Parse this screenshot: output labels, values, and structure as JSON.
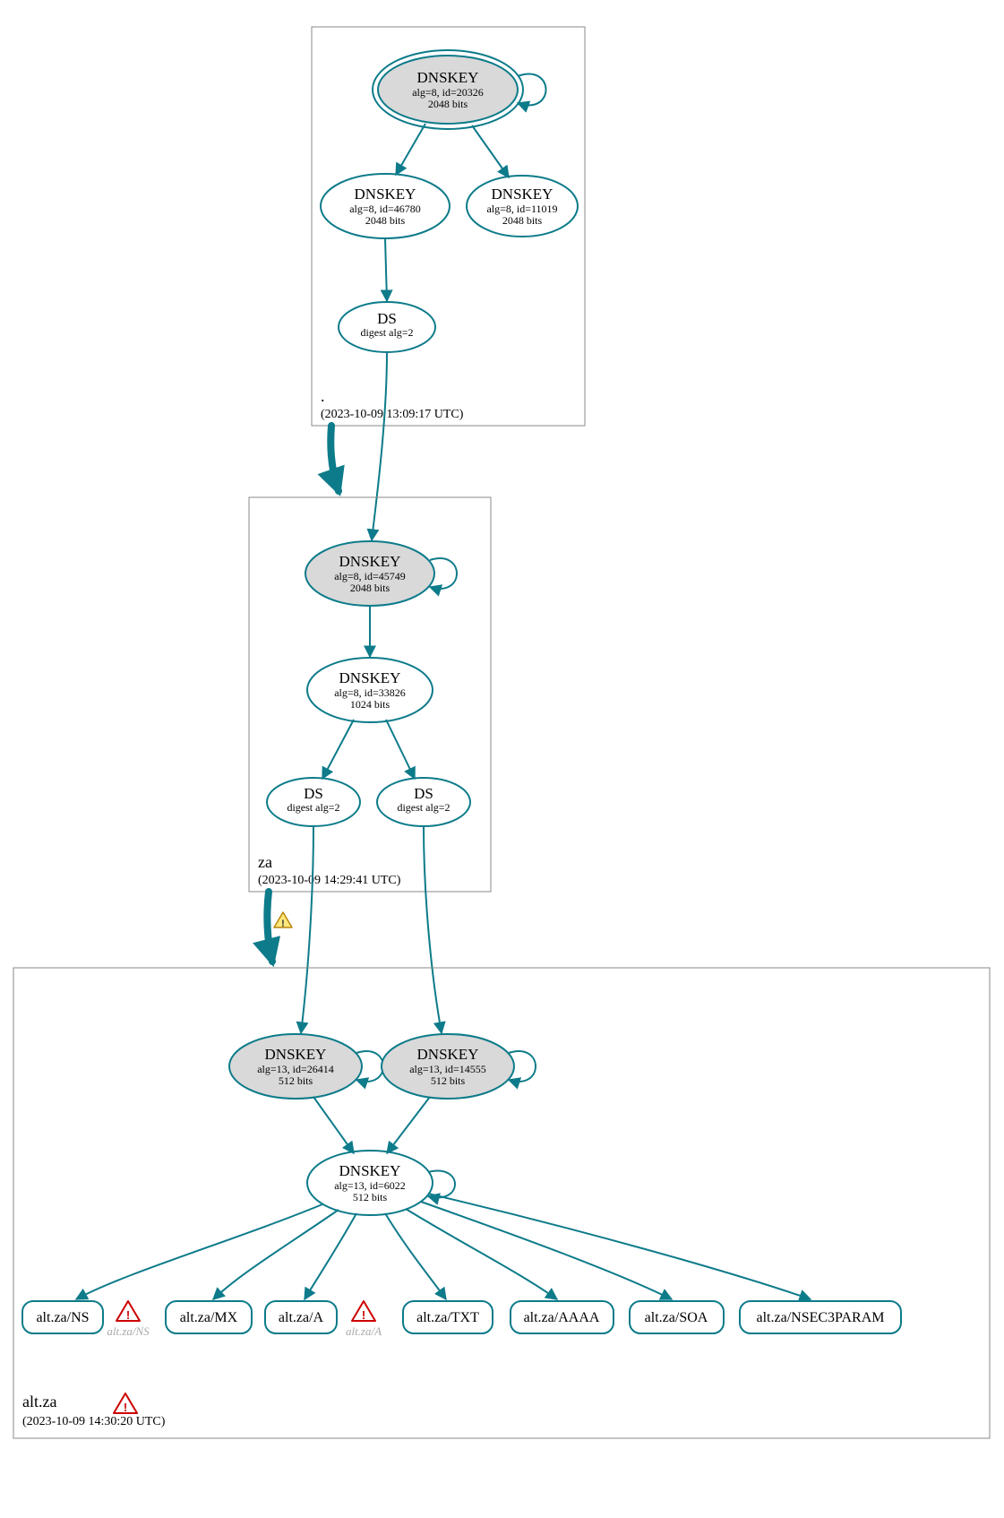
{
  "colors": {
    "stroke": "#0d7b8a",
    "shaded": "#d9d9d9"
  },
  "zones": {
    "root": {
      "name": ".",
      "timestamp": "(2023-10-09 13:09:17 UTC)"
    },
    "za": {
      "name": "za",
      "timestamp": "(2023-10-09 14:29:41 UTC)"
    },
    "altza": {
      "name": "alt.za",
      "timestamp": "(2023-10-09 14:30:20 UTC)"
    }
  },
  "nodes": {
    "root_ksk": {
      "title": "DNSKEY",
      "line1": "alg=8, id=20326",
      "line2": "2048 bits"
    },
    "root_zsk1": {
      "title": "DNSKEY",
      "line1": "alg=8, id=46780",
      "line2": "2048 bits"
    },
    "root_zsk2": {
      "title": "DNSKEY",
      "line1": "alg=8, id=11019",
      "line2": "2048 bits"
    },
    "root_ds": {
      "title": "DS",
      "line1": "digest alg=2"
    },
    "za_ksk": {
      "title": "DNSKEY",
      "line1": "alg=8, id=45749",
      "line2": "2048 bits"
    },
    "za_zsk": {
      "title": "DNSKEY",
      "line1": "alg=8, id=33826",
      "line2": "1024 bits"
    },
    "za_ds1": {
      "title": "DS",
      "line1": "digest alg=2"
    },
    "za_ds2": {
      "title": "DS",
      "line1": "digest alg=2"
    },
    "altza_ksk1": {
      "title": "DNSKEY",
      "line1": "alg=13, id=26414",
      "line2": "512 bits"
    },
    "altza_ksk2": {
      "title": "DNSKEY",
      "line1": "alg=13, id=14555",
      "line2": "512 bits"
    },
    "altza_zsk": {
      "title": "DNSKEY",
      "line1": "alg=13, id=6022",
      "line2": "512 bits"
    }
  },
  "records": {
    "ns": "alt.za/NS",
    "ns_grey": "alt.za/NS",
    "mx": "alt.za/MX",
    "a": "alt.za/A",
    "a_grey": "alt.za/A",
    "txt": "alt.za/TXT",
    "aaaa": "alt.za/AAAA",
    "soa": "alt.za/SOA",
    "nsec": "alt.za/NSEC3PARAM"
  },
  "chart_data": {
    "type": "diagram",
    "description": "DNSSEC authentication chain (DNSViz-style) from root to za to alt.za",
    "zones": [
      {
        "name": ".",
        "analyzed_at": "2023-10-09 13:09:17 UTC",
        "keys": [
          {
            "type": "DNSKEY",
            "alg": 8,
            "id": 20326,
            "bits": 2048,
            "role": "KSK",
            "trust_anchor": true,
            "self_signed": true
          },
          {
            "type": "DNSKEY",
            "alg": 8,
            "id": 46780,
            "bits": 2048,
            "role": "ZSK"
          },
          {
            "type": "DNSKEY",
            "alg": 8,
            "id": 11019,
            "bits": 2048,
            "role": "ZSK"
          }
        ],
        "ds_for_child": [
          {
            "child": "za",
            "digest_alg": 2,
            "signed_by_id": 46780
          }
        ]
      },
      {
        "name": "za",
        "analyzed_at": "2023-10-09 14:29:41 UTC",
        "keys": [
          {
            "type": "DNSKEY",
            "alg": 8,
            "id": 45749,
            "bits": 2048,
            "role": "KSK",
            "self_signed": true
          },
          {
            "type": "DNSKEY",
            "alg": 8,
            "id": 33826,
            "bits": 1024,
            "role": "ZSK"
          }
        ],
        "ds_for_child": [
          {
            "child": "alt.za",
            "digest_alg": 2,
            "signed_by_id": 33826
          },
          {
            "child": "alt.za",
            "digest_alg": 2,
            "signed_by_id": 33826
          }
        ],
        "delegation_status": "warning"
      },
      {
        "name": "alt.za",
        "analyzed_at": "2023-10-09 14:30:20 UTC",
        "status": "error",
        "keys": [
          {
            "type": "DNSKEY",
            "alg": 13,
            "id": 26414,
            "bits": 512,
            "role": "KSK",
            "self_signed": true
          },
          {
            "type": "DNSKEY",
            "alg": 13,
            "id": 14555,
            "bits": 512,
            "role": "KSK",
            "self_signed": true
          },
          {
            "type": "DNSKEY",
            "alg": 13,
            "id": 6022,
            "bits": 512,
            "role": "ZSK",
            "self_signed": true
          }
        ],
        "rrsets_signed_by_6022": [
          "alt.za/NS",
          "alt.za/MX",
          "alt.za/A",
          "alt.za/TXT",
          "alt.za/AAAA",
          "alt.za/SOA",
          "alt.za/NSEC3PARAM"
        ],
        "rrsets_with_errors": [
          "alt.za/NS",
          "alt.za/A"
        ]
      }
    ],
    "edges": [
      {
        "from": "./DNSKEY/20326",
        "to": "./DNSKEY/20326",
        "kind": "self-loop"
      },
      {
        "from": "./DNSKEY/20326",
        "to": "./DNSKEY/46780"
      },
      {
        "from": "./DNSKEY/20326",
        "to": "./DNSKEY/11019"
      },
      {
        "from": "./DNSKEY/46780",
        "to": "za/DS"
      },
      {
        "from": "za/DS",
        "to": "za/DNSKEY/45749"
      },
      {
        "from": "za/DNSKEY/45749",
        "to": "za/DNSKEY/45749",
        "kind": "self-loop"
      },
      {
        "from": "za/DNSKEY/45749",
        "to": "za/DNSKEY/33826"
      },
      {
        "from": "za/DNSKEY/33826",
        "to": "alt.za/DS(1)"
      },
      {
        "from": "za/DNSKEY/33826",
        "to": "alt.za/DS(2)"
      },
      {
        "from": "alt.za/DS(1)",
        "to": "alt.za/DNSKEY/26414"
      },
      {
        "from": "alt.za/DS(2)",
        "to": "alt.za/DNSKEY/14555"
      },
      {
        "from": "alt.za/DNSKEY/26414",
        "to": "alt.za/DNSKEY/26414",
        "kind": "self-loop"
      },
      {
        "from": "alt.za/DNSKEY/14555",
        "to": "alt.za/DNSKEY/14555",
        "kind": "self-loop"
      },
      {
        "from": "alt.za/DNSKEY/26414",
        "to": "alt.za/DNSKEY/6022"
      },
      {
        "from": "alt.za/DNSKEY/14555",
        "to": "alt.za/DNSKEY/6022"
      },
      {
        "from": "alt.za/DNSKEY/6022",
        "to": "alt.za/DNSKEY/6022",
        "kind": "self-loop"
      },
      {
        "from": "alt.za/DNSKEY/6022",
        "to": "alt.za/NS"
      },
      {
        "from": "alt.za/DNSKEY/6022",
        "to": "alt.za/MX"
      },
      {
        "from": "alt.za/DNSKEY/6022",
        "to": "alt.za/A"
      },
      {
        "from": "alt.za/DNSKEY/6022",
        "to": "alt.za/TXT"
      },
      {
        "from": "alt.za/DNSKEY/6022",
        "to": "alt.za/AAAA"
      },
      {
        "from": "alt.za/DNSKEY/6022",
        "to": "alt.za/SOA"
      },
      {
        "from": "alt.za/DNSKEY/6022",
        "to": "alt.za/NSEC3PARAM"
      }
    ]
  }
}
